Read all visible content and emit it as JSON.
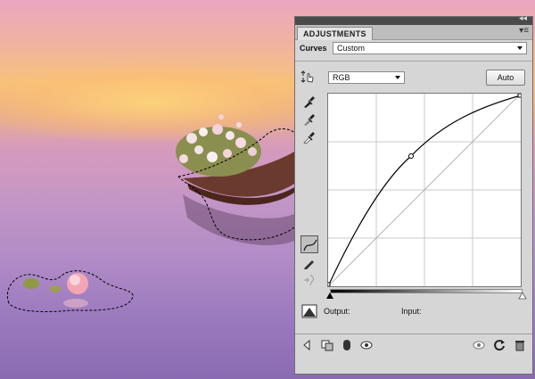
{
  "panel": {
    "title": "ADJUSTMENTS",
    "menu_icon": "panel-menu-icon",
    "collapse_icon": "collapse-arrows-icon",
    "adjustment_type": "Curves",
    "preset_value": "Custom",
    "channel_value": "RGB",
    "auto_label": "Auto",
    "output_label": "Output:",
    "input_label": "Input:"
  },
  "tools": {
    "left": [
      "on-image-adjust-icon",
      "black-eyedropper-icon",
      "gray-eyedropper-icon",
      "white-eyedropper-icon",
      "curve-edit-icon",
      "pencil-draw-icon",
      "smooth-curve-icon"
    ],
    "bottom": [
      "return-to-list-icon",
      "clip-layer-icon",
      "visibility-eye-icon",
      "view-previous-icon",
      "reset-icon",
      "refresh-icon",
      "trash-icon"
    ]
  },
  "curve": {
    "control_points": [
      [
        0,
        0
      ],
      [
        121,
        180
      ],
      [
        255,
        255
      ]
    ]
  },
  "colors": {
    "panel_bg": "#d6d6d6",
    "tab_bg": "#e3e3e3",
    "accent_dark": "#4a4a4a"
  }
}
